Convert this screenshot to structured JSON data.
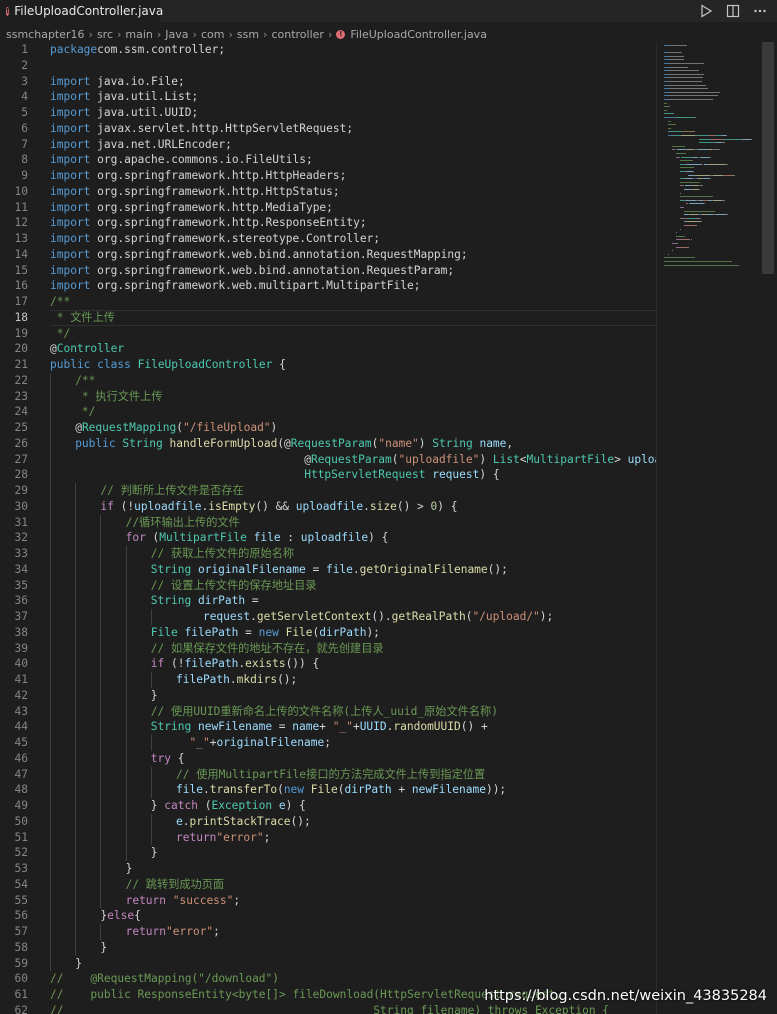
{
  "tab": {
    "filename": "FileUploadController.java",
    "icon": "java-error-icon",
    "dirty": true
  },
  "toolbar": {
    "run_icon": "play-icon",
    "split_icon": "split-editor-icon",
    "more_icon": "more-actions-icon"
  },
  "breadcrumb": [
    "ssmchapter16",
    "src",
    "main",
    "Java",
    "com",
    "ssm",
    "controller",
    "FileUploadController.java"
  ],
  "editor": {
    "current_line": 18,
    "lines": [
      {
        "n": 1,
        "indent": 0,
        "tokens": [
          [
            "kw",
            "package"
          ],
          [
            "",
            "com.ssm.controller;"
          ]
        ]
      },
      {
        "n": 2,
        "indent": 0,
        "tokens": []
      },
      {
        "n": 3,
        "indent": 0,
        "tokens": [
          [
            "kw",
            "import"
          ],
          [
            "",
            " java.io.File;"
          ]
        ]
      },
      {
        "n": 4,
        "indent": 0,
        "tokens": [
          [
            "kw",
            "import"
          ],
          [
            "",
            " java.util.List;"
          ]
        ]
      },
      {
        "n": 5,
        "indent": 0,
        "tokens": [
          [
            "kw",
            "import"
          ],
          [
            "",
            " java.util.UUID;"
          ]
        ]
      },
      {
        "n": 6,
        "indent": 0,
        "tokens": [
          [
            "kw",
            "import"
          ],
          [
            "",
            " javax.servlet.http.HttpServletRequest;"
          ]
        ]
      },
      {
        "n": 7,
        "indent": 0,
        "tokens": [
          [
            "kw",
            "import"
          ],
          [
            "",
            " java.net.URLEncoder;"
          ]
        ]
      },
      {
        "n": 8,
        "indent": 0,
        "tokens": [
          [
            "kw",
            "import"
          ],
          [
            "",
            " org.apache.commons.io.FileUtils;"
          ]
        ]
      },
      {
        "n": 9,
        "indent": 0,
        "tokens": [
          [
            "kw",
            "import"
          ],
          [
            "",
            " org.springframework.http.HttpHeaders;"
          ]
        ]
      },
      {
        "n": 10,
        "indent": 0,
        "tokens": [
          [
            "kw",
            "import"
          ],
          [
            "",
            " org.springframework.http.HttpStatus;"
          ]
        ]
      },
      {
        "n": 11,
        "indent": 0,
        "tokens": [
          [
            "kw",
            "import"
          ],
          [
            "",
            " org.springframework.http.MediaType;"
          ]
        ]
      },
      {
        "n": 12,
        "indent": 0,
        "tokens": [
          [
            "kw",
            "import"
          ],
          [
            "",
            " org.springframework.http.ResponseEntity;"
          ]
        ]
      },
      {
        "n": 13,
        "indent": 0,
        "tokens": [
          [
            "kw",
            "import"
          ],
          [
            "",
            " org.springframework.stereotype.Controller;"
          ]
        ]
      },
      {
        "n": 14,
        "indent": 0,
        "tokens": [
          [
            "kw",
            "import"
          ],
          [
            "",
            " org.springframework.web.bind.annotation.RequestMapping;"
          ]
        ]
      },
      {
        "n": 15,
        "indent": 0,
        "tokens": [
          [
            "kw",
            "import"
          ],
          [
            "",
            " org.springframework.web.bind.annotation.RequestParam;"
          ]
        ]
      },
      {
        "n": 16,
        "indent": 0,
        "tokens": [
          [
            "kw",
            "import"
          ],
          [
            "",
            " org.springframework.web.multipart.MultipartFile;"
          ]
        ]
      },
      {
        "n": 17,
        "indent": 0,
        "tokens": [
          [
            "cmt",
            "/**"
          ]
        ]
      },
      {
        "n": 18,
        "indent": 0,
        "tokens": [
          [
            "cmt",
            " * 文件上传"
          ]
        ]
      },
      {
        "n": 19,
        "indent": 0,
        "tokens": [
          [
            "cmt",
            " */"
          ]
        ]
      },
      {
        "n": 20,
        "indent": 0,
        "tokens": [
          [
            "",
            "@"
          ],
          [
            "type",
            "Controller"
          ]
        ]
      },
      {
        "n": 21,
        "indent": 0,
        "tokens": [
          [
            "kw",
            "public"
          ],
          [
            "",
            " "
          ],
          [
            "kw",
            "class"
          ],
          [
            "",
            " "
          ],
          [
            "type",
            "FileUploadController"
          ],
          [
            "",
            " {"
          ]
        ]
      },
      {
        "n": 22,
        "indent": 1,
        "tokens": [
          [
            "cmt",
            "/**"
          ]
        ]
      },
      {
        "n": 23,
        "indent": 1,
        "tokens": [
          [
            "cmt",
            " * 执行文件上传"
          ]
        ]
      },
      {
        "n": 24,
        "indent": 1,
        "tokens": [
          [
            "cmt",
            " */"
          ]
        ]
      },
      {
        "n": 25,
        "indent": 1,
        "tokens": [
          [
            "",
            "@"
          ],
          [
            "type",
            "RequestMapping"
          ],
          [
            "",
            "("
          ],
          [
            "str",
            "\"/fileUpload\""
          ],
          [
            "",
            ")"
          ]
        ]
      },
      {
        "n": 26,
        "indent": 1,
        "tokens": [
          [
            "kw",
            "public"
          ],
          [
            "",
            " "
          ],
          [
            "type",
            "String"
          ],
          [
            "",
            " "
          ],
          [
            "fn",
            "handleFormUpload"
          ],
          [
            "",
            "(@"
          ],
          [
            "type",
            "RequestParam"
          ],
          [
            "",
            "("
          ],
          [
            "str",
            "\"name\""
          ],
          [
            "",
            ") "
          ],
          [
            "type",
            "String"
          ],
          [
            "",
            " "
          ],
          [
            "var",
            "name"
          ],
          [
            "",
            ","
          ]
        ]
      },
      {
        "n": 27,
        "indent": 1,
        "pad": "                                  ",
        "tokens": [
          [
            "",
            "@"
          ],
          [
            "type",
            "RequestParam"
          ],
          [
            "",
            "("
          ],
          [
            "str",
            "\"uploadfile\""
          ],
          [
            "",
            ") "
          ],
          [
            "type",
            "List"
          ],
          [
            "",
            "<"
          ],
          [
            "type",
            "MultipartFile"
          ],
          [
            "",
            "> "
          ],
          [
            "var",
            "uploadfile"
          ],
          [
            "",
            ","
          ]
        ]
      },
      {
        "n": 28,
        "indent": 1,
        "pad": "                                  ",
        "tokens": [
          [
            "type",
            "HttpServletRequest"
          ],
          [
            "",
            " "
          ],
          [
            "var",
            "request"
          ],
          [
            "",
            ") {"
          ]
        ]
      },
      {
        "n": 29,
        "indent": 2,
        "tokens": [
          [
            "cmt",
            "// 判断所上传文件是否存在"
          ]
        ]
      },
      {
        "n": 30,
        "indent": 2,
        "tokens": [
          [
            "ctl",
            "if"
          ],
          [
            "",
            " (!"
          ],
          [
            "var",
            "uploadfile"
          ],
          [
            "",
            "."
          ],
          [
            "fn",
            "isEmpty"
          ],
          [
            "",
            "() && "
          ],
          [
            "var",
            "uploadfile"
          ],
          [
            "",
            "."
          ],
          [
            "fn",
            "size"
          ],
          [
            "",
            "() > "
          ],
          [
            "num",
            "0"
          ],
          [
            "",
            ") {"
          ]
        ]
      },
      {
        "n": 31,
        "indent": 3,
        "tokens": [
          [
            "cmt",
            "//循环输出上传的文件"
          ]
        ]
      },
      {
        "n": 32,
        "indent": 3,
        "tokens": [
          [
            "ctl",
            "for"
          ],
          [
            "",
            " ("
          ],
          [
            "type",
            "MultipartFile"
          ],
          [
            "",
            " "
          ],
          [
            "var",
            "file"
          ],
          [
            "",
            " : "
          ],
          [
            "var",
            "uploadfile"
          ],
          [
            "",
            ") {"
          ]
        ]
      },
      {
        "n": 33,
        "indent": 4,
        "tokens": [
          [
            "cmt",
            "// 获取上传文件的原始名称"
          ]
        ]
      },
      {
        "n": 34,
        "indent": 4,
        "tokens": [
          [
            "type",
            "String"
          ],
          [
            "",
            " "
          ],
          [
            "var",
            "originalFilename"
          ],
          [
            "",
            " = "
          ],
          [
            "var",
            "file"
          ],
          [
            "",
            "."
          ],
          [
            "fn",
            "getOriginalFilename"
          ],
          [
            "",
            "();"
          ]
        ]
      },
      {
        "n": 35,
        "indent": 4,
        "tokens": [
          [
            "cmt",
            "// 设置上传文件的保存地址目录"
          ]
        ]
      },
      {
        "n": 36,
        "indent": 4,
        "tokens": [
          [
            "type",
            "String"
          ],
          [
            "",
            " "
          ],
          [
            "var",
            "dirPath"
          ],
          [
            "",
            " ="
          ]
        ]
      },
      {
        "n": 37,
        "indent": 5,
        "pad": "    ",
        "tokens": [
          [
            "var",
            "request"
          ],
          [
            "",
            "."
          ],
          [
            "fn",
            "getServletContext"
          ],
          [
            "",
            "()."
          ],
          [
            "fn",
            "getRealPath"
          ],
          [
            "",
            "("
          ],
          [
            "str",
            "\"/upload/\""
          ],
          [
            "",
            ");"
          ]
        ]
      },
      {
        "n": 38,
        "indent": 4,
        "tokens": [
          [
            "type",
            "File"
          ],
          [
            "",
            " "
          ],
          [
            "var",
            "filePath"
          ],
          [
            "",
            " = "
          ],
          [
            "kw",
            "new"
          ],
          [
            "",
            " "
          ],
          [
            "fn",
            "File"
          ],
          [
            "",
            "("
          ],
          [
            "var",
            "dirPath"
          ],
          [
            "",
            ");"
          ]
        ]
      },
      {
        "n": 39,
        "indent": 4,
        "tokens": [
          [
            "cmt",
            "// 如果保存文件的地址不存在，就先创建目录"
          ]
        ]
      },
      {
        "n": 40,
        "indent": 4,
        "tokens": [
          [
            "ctl",
            "if"
          ],
          [
            "",
            " (!"
          ],
          [
            "var",
            "filePath"
          ],
          [
            "",
            "."
          ],
          [
            "fn",
            "exists"
          ],
          [
            "",
            "()) {"
          ]
        ]
      },
      {
        "n": 41,
        "indent": 5,
        "tokens": [
          [
            "var",
            "filePath"
          ],
          [
            "",
            "."
          ],
          [
            "fn",
            "mkdirs"
          ],
          [
            "",
            "();"
          ]
        ]
      },
      {
        "n": 42,
        "indent": 4,
        "tokens": [
          [
            "",
            "}"
          ]
        ]
      },
      {
        "n": 43,
        "indent": 4,
        "tokens": [
          [
            "cmt",
            "// 使用UUID重新命名上传的文件名称(上传人_uuid_原始文件名称)"
          ]
        ]
      },
      {
        "n": 44,
        "indent": 4,
        "tokens": [
          [
            "type",
            "String"
          ],
          [
            "",
            " "
          ],
          [
            "var",
            "newFilename"
          ],
          [
            "",
            " = "
          ],
          [
            "var",
            "name"
          ],
          [
            "",
            "+ "
          ],
          [
            "str",
            "\"_\""
          ],
          [
            "",
            "+"
          ],
          [
            "var",
            "UUID"
          ],
          [
            "",
            "."
          ],
          [
            "fn",
            "randomUUID"
          ],
          [
            "",
            "() +"
          ]
        ]
      },
      {
        "n": 45,
        "indent": 5,
        "pad": "  ",
        "tokens": [
          [
            "str",
            "\"_\""
          ],
          [
            "",
            "+"
          ],
          [
            "var",
            "originalFilename"
          ],
          [
            "",
            ";"
          ]
        ]
      },
      {
        "n": 46,
        "indent": 4,
        "tokens": [
          [
            "ctl",
            "try"
          ],
          [
            "",
            " {"
          ]
        ]
      },
      {
        "n": 47,
        "indent": 5,
        "tokens": [
          [
            "cmt",
            "// 使用MultipartFile接口的方法完成文件上传到指定位置"
          ]
        ]
      },
      {
        "n": 48,
        "indent": 5,
        "tokens": [
          [
            "var",
            "file"
          ],
          [
            "",
            "."
          ],
          [
            "fn",
            "transferTo"
          ],
          [
            "",
            "("
          ],
          [
            "kw",
            "new"
          ],
          [
            "",
            " "
          ],
          [
            "fn",
            "File"
          ],
          [
            "",
            "("
          ],
          [
            "var",
            "dirPath"
          ],
          [
            "",
            " + "
          ],
          [
            "var",
            "newFilename"
          ],
          [
            "",
            "));"
          ]
        ]
      },
      {
        "n": 49,
        "indent": 4,
        "tokens": [
          [
            "",
            "} "
          ],
          [
            "ctl",
            "catch"
          ],
          [
            "",
            " ("
          ],
          [
            "type",
            "Exception"
          ],
          [
            "",
            " "
          ],
          [
            "var",
            "e"
          ],
          [
            "",
            ") {"
          ]
        ]
      },
      {
        "n": 50,
        "indent": 5,
        "tokens": [
          [
            "var",
            "e"
          ],
          [
            "",
            "."
          ],
          [
            "fn",
            "printStackTrace"
          ],
          [
            "",
            "();"
          ]
        ]
      },
      {
        "n": 51,
        "indent": 5,
        "tokens": [
          [
            "ctl",
            "return"
          ],
          [
            "str",
            "\"error\""
          ],
          [
            "",
            ";"
          ]
        ]
      },
      {
        "n": 52,
        "indent": 4,
        "tokens": [
          [
            "",
            "}"
          ]
        ]
      },
      {
        "n": 53,
        "indent": 3,
        "tokens": [
          [
            "",
            "}"
          ]
        ]
      },
      {
        "n": 54,
        "indent": 3,
        "tokens": [
          [
            "cmt",
            "// 跳转到成功页面"
          ]
        ]
      },
      {
        "n": 55,
        "indent": 3,
        "tokens": [
          [
            "ctl",
            "return"
          ],
          [
            "",
            " "
          ],
          [
            "str",
            "\"success\""
          ],
          [
            "",
            ";"
          ]
        ]
      },
      {
        "n": 56,
        "indent": 2,
        "tokens": [
          [
            "",
            "}"
          ],
          [
            "ctl",
            "else"
          ],
          [
            "",
            "{"
          ]
        ]
      },
      {
        "n": 57,
        "indent": 3,
        "tokens": [
          [
            "ctl",
            "return"
          ],
          [
            "str",
            "\"error\""
          ],
          [
            "",
            ";"
          ]
        ]
      },
      {
        "n": 58,
        "indent": 2,
        "tokens": [
          [
            "",
            "}"
          ]
        ]
      },
      {
        "n": 59,
        "indent": 1,
        "tokens": [
          [
            "",
            "}"
          ]
        ]
      },
      {
        "n": 60,
        "indent": 0,
        "tokens": [
          [
            "cmt",
            "//    @RequestMapping(\"/download\")"
          ]
        ]
      },
      {
        "n": 61,
        "indent": 0,
        "tokens": [
          [
            "cmt",
            "//    public ResponseEntity<byte[]> fileDownload(HttpServletRequest request,"
          ]
        ]
      },
      {
        "n": 62,
        "indent": 0,
        "tokens": [
          [
            "cmt",
            "//                                              String filename) throws Exception {"
          ]
        ]
      }
    ]
  },
  "watermark": "https://blog.csdn.net/weixin_43835284",
  "colors": {
    "background": "#1e1e1e",
    "keyword": "#569cd6",
    "control": "#c586c0",
    "type": "#4ec9b0",
    "variable": "#9cdcfe",
    "string": "#ce9178",
    "comment": "#6a9955",
    "function": "#dcdcaa",
    "error_icon": "#e06c75"
  }
}
